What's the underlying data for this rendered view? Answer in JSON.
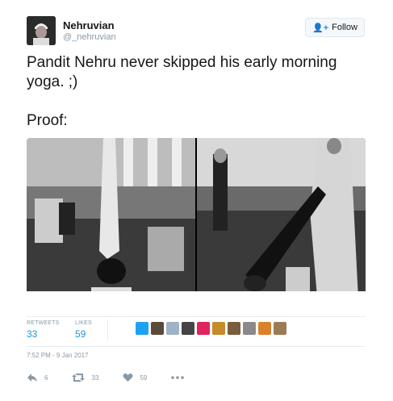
{
  "author": {
    "name": "Nehruvian",
    "handle": "@_nehruvian"
  },
  "follow_button": {
    "label": "Follow"
  },
  "tweet": {
    "line1": "Pandit Nehru never skipped his early morning yoga. ;)",
    "line2": "Proof:"
  },
  "media": {
    "photos": [
      {
        "description": "black and white photo of man doing headstand by pool"
      },
      {
        "description": "black and white photo of man doing yoga pose outdoors"
      }
    ]
  },
  "stats": {
    "retweets_label": "RETWEETS",
    "retweets_count": "33",
    "likes_label": "LIKES",
    "likes_count": "59"
  },
  "timestamp": "7:52 PM - 9 Jan 2017",
  "actions": {
    "reply_count": "6",
    "retweet_count": "33",
    "like_count": "59"
  },
  "colors": {
    "accent": "#1b95e0",
    "muted": "#8899a6",
    "text": "#14171a"
  }
}
